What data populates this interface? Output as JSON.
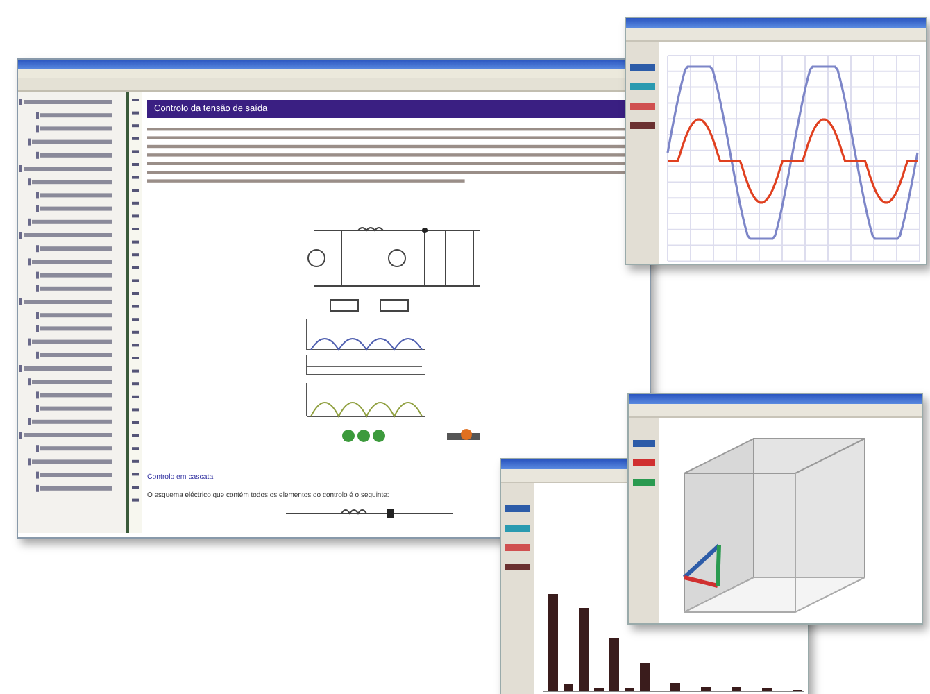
{
  "main_window": {
    "heading": "Controlo da tensão de saída",
    "subheading": "Controlo em cascata",
    "sentence": "O esquema eléctrico que contém todos os elementos do controlo é o seguinte:"
  },
  "windows": [
    {
      "kind": "wave"
    },
    {
      "kind": "bars"
    },
    {
      "kind": "cube"
    }
  ]
}
